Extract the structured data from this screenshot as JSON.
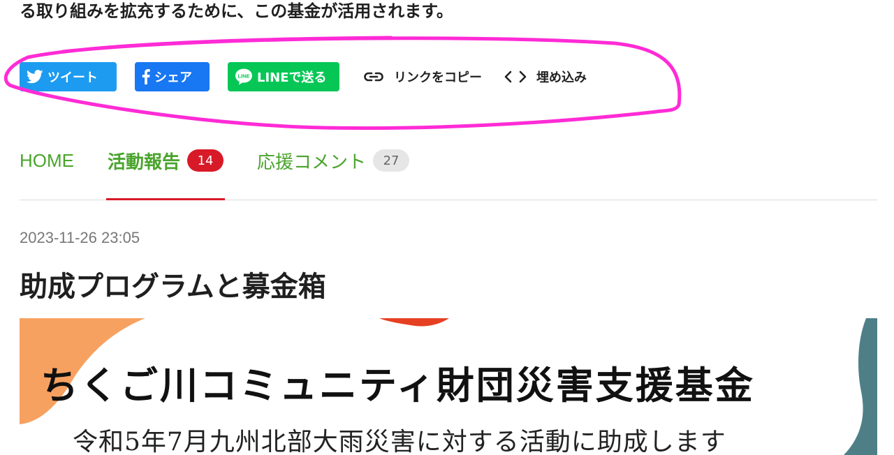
{
  "intro": {
    "text": "る取り組みを拡充するために、この基金が活用されます。"
  },
  "share": {
    "tweet_label": "ツイート",
    "facebook_label": "シェア",
    "line_label": "LINEで送る",
    "line_icon_text": "LINE",
    "copy_link_label": "リンクをコピー",
    "embed_label": "埋め込み"
  },
  "tabs": [
    {
      "label": "HOME"
    },
    {
      "label": "活動報告",
      "count": "14",
      "active": true
    },
    {
      "label": "応援コメント",
      "count": "27"
    }
  ],
  "post": {
    "date": "2023-11-26 23:05",
    "title": "助成プログラムと募金箱"
  },
  "banner": {
    "title": "ちくご川コミュニティ財団災害支援基金",
    "subtitle": "令和5年7月九州北部大雨災害に対する活動に助成します"
  },
  "colors": {
    "tweet": "#1d9bf0",
    "facebook": "#1877f2",
    "line": "#06c755",
    "tab_text": "#4aa42c",
    "active_underline": "#d81a28",
    "annotation": "#ff2bd6"
  }
}
